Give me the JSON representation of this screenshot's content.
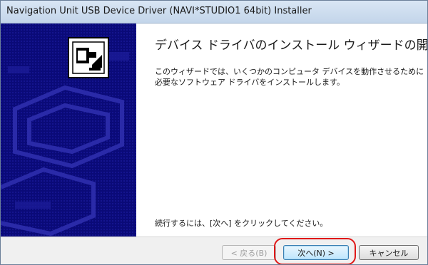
{
  "window": {
    "title": "Navigation Unit USB Device Driver (NAVI*STUDIO1 64bit) Installer"
  },
  "banner": {
    "icon": "usb-plug-icon"
  },
  "content": {
    "heading": "デバイス ドライバのインストール ウィザードの開始",
    "description_line1": "このウィザードでは、いくつかのコンピュータ デバイスを動作させるために",
    "description_line2": "必要なソフトウェア ドライバをインストールします。",
    "continue_hint": "続行するには、[次へ] をクリックしてください。"
  },
  "buttons": {
    "back": "< 戻る(B)",
    "next": "次へ(N) >",
    "cancel": "キャンセル"
  },
  "colors": {
    "banner_bg": "#0a0a78",
    "highlight": "#e01818"
  }
}
